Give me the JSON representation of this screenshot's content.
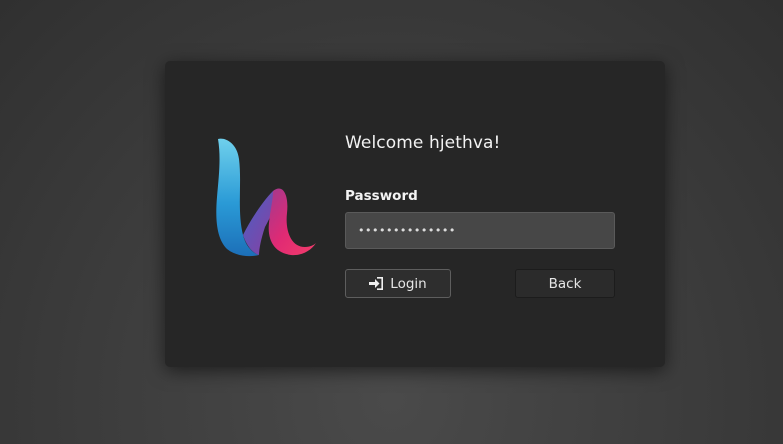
{
  "login_card": {
    "welcome_text": "Welcome hjethva!",
    "password_label": "Password",
    "password_value": "••••••••••••••",
    "login_button_label": "Login",
    "back_button_label": "Back"
  },
  "icons": {
    "logo": "brand-logo-h",
    "login": "sign-in-icon"
  },
  "colors": {
    "logo_blue": "#29a6dc",
    "logo_purple": "#7a3a9a",
    "logo_pink": "#e5246c"
  }
}
